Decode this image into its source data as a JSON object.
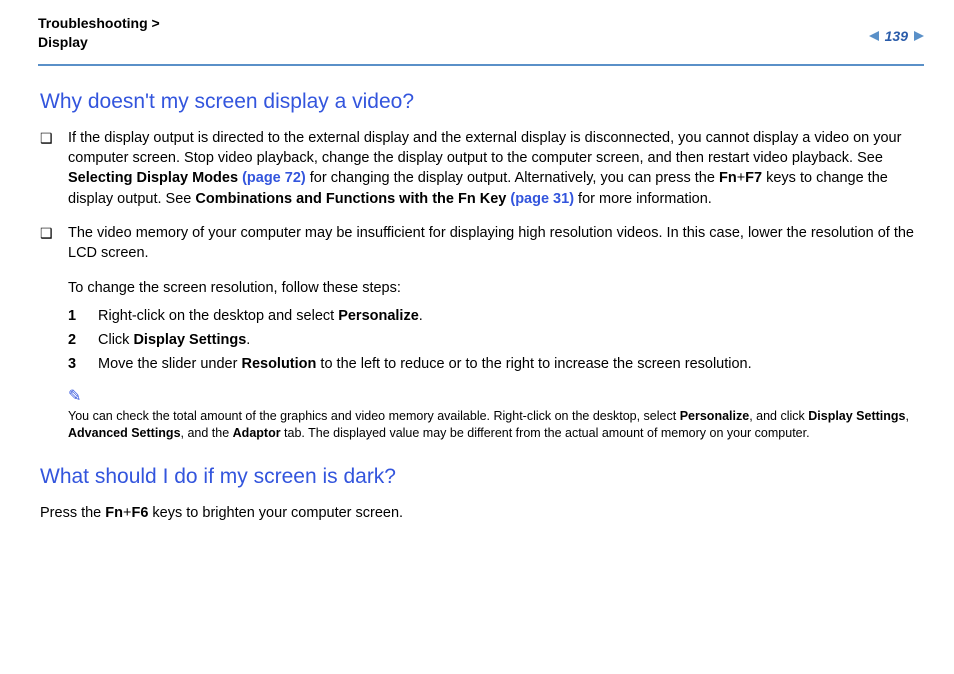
{
  "breadcrumb": {
    "line1": "Troubleshooting >",
    "line2": "Display"
  },
  "page_number": "139",
  "q1": {
    "title": "Why doesn't my screen display a video?",
    "b1_pre": "If the display output is directed to the external display and the external display is disconnected, you cannot display a video on your computer screen. Stop video playback, change the display output to the computer screen, and then restart video playback. See ",
    "b1_link1_label": "Selecting Display Modes ",
    "b1_link1_page": "(page 72)",
    "b1_mid1": " for changing the display output. Alternatively, you can press the ",
    "b1_fn": "Fn",
    "b1_plus": "+",
    "b1_f7": "F7",
    "b1_mid2": " keys to change the display output. See ",
    "b1_link2_label": "Combinations and Functions with the Fn Key ",
    "b1_link2_page": "(page 31)",
    "b1_post": " for more information.",
    "b2": "The video memory of your computer may be insufficient for displaying high resolution videos. In this case, lower the resolution of the LCD screen.",
    "steps_intro": "To change the screen resolution, follow these steps:",
    "step1_pre": "Right-click on the desktop and select ",
    "step1_bold": "Personalize",
    "step1_post": ".",
    "step2_pre": "Click ",
    "step2_bold": "Display Settings",
    "step2_post": ".",
    "step3_pre": "Move the slider under ",
    "step3_bold": "Resolution",
    "step3_post": " to the left to reduce or to the right to increase the screen resolution.",
    "note_pre": "You can check the total amount of the graphics and video memory available. Right-click on the desktop, select ",
    "note_b1": "Personalize",
    "note_mid1": ", and click ",
    "note_b2": "Display Settings",
    "note_mid2": ", ",
    "note_b3": "Advanced Settings",
    "note_mid3": ", and the ",
    "note_b4": "Adaptor",
    "note_post": " tab. The displayed value may be different from the actual amount of memory on your computer."
  },
  "q2": {
    "title": "What should I do if my screen is dark?",
    "body_pre": "Press the ",
    "fn": "Fn",
    "plus": "+",
    "f6": "F6",
    "body_post": " keys to brighten your computer screen."
  },
  "nums": {
    "n1": "1",
    "n2": "2",
    "n3": "3"
  },
  "pencil": "✎"
}
